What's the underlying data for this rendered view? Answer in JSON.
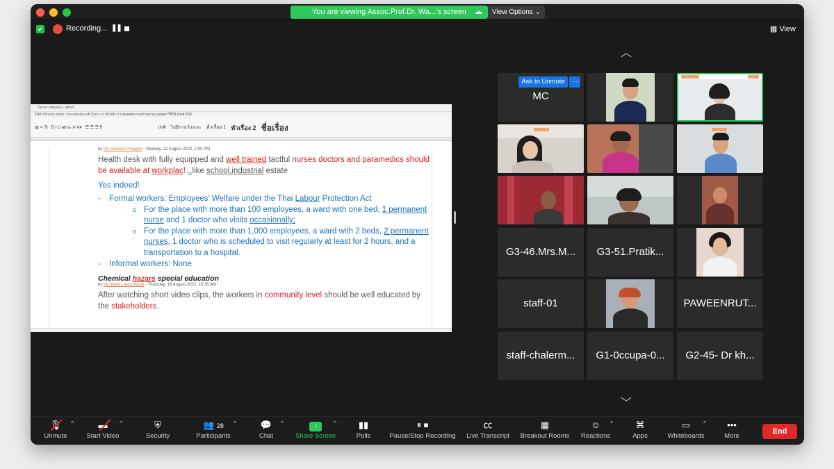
{
  "titlebar": {
    "share_banner": "You are viewing Assoc.Prof.Dr. Wa...'s screen",
    "view_options": "View Options ⌄"
  },
  "top_bar": {
    "recording_label": "Recording...",
    "view_label": "View"
  },
  "shared_doc": {
    "window_title": "โครงการสัมมนา - Word",
    "tabs": "ไฟล์   หน้าแรก   แทรก   วาด   ออกแบบ   เค้าโครง   การอ้างอิง   การส่งจดหมาย   ตรวจทาน   มุมมอง   วิธีใช้   Foxit PDF",
    "ribbon_styles": [
      "ปกติ",
      "ไม่มีการเว้นระยะ",
      "หัวเรื่อง 1",
      "หัวเรื่อง 2",
      "ชื่อเรื่อง"
    ],
    "meta1_prefix": "by ",
    "meta1_author": "Ms.Sareeta Prajapati",
    "meta1_date": " - Monday, 22 August 2022, 2:50 PM",
    "para1_a": "Health desk with fully equipped and ",
    "para1_b": "well trained",
    "para1_c": " tactful ",
    "para1_d": "nurses doctors and paramedics should be available at ",
    "para1_e": "workplac",
    "para1_f": "! ",
    "para1_g": "..",
    "para1_h": "like ",
    "para1_i": "school,industrial",
    "para1_j": " estate",
    "yes": "Yes indeed!",
    "formal_a": "Formal workers: Employees' Welfare under the Thai ",
    "formal_b": "Labour",
    "formal_c": " Protection Act",
    "sub1_a": "For the place with more than 100 employees, a ward with one bed, ",
    "sub1_b": "1 permanent nurse",
    "sub1_c": " and 1 doctor who visits ",
    "sub1_d": "occasionally;",
    "sub2_a": "For the place with more than 1,000 employees, a ward with 2 beds, ",
    "sub2_b": "2 permanent nurses",
    "sub2_c": ", 1 doctor who is scheduled to visit regularly at least for 2 hours, and a transportation to a hospital.",
    "informal": "Informal workers: None",
    "heading_a": "Chemical ",
    "heading_b": "hazars",
    "heading_c": " special education",
    "meta2_prefix": "by ",
    "meta2_author": "Mr.Nabin Lamichhane",
    "meta2_date": " - Thursday, 18 August 2022, 10:35 AM",
    "para2_a": "After watching short video clips, the workers in ",
    "para2_b": "community level",
    "para2_c": " should be well educated by the ",
    "para2_d": "stakeholders",
    "para2_e": "."
  },
  "gallery": {
    "mc_name": "MC",
    "ask_to_unmute": "Ask to Unmute",
    "more": "···",
    "names": [
      "G3-46.Mrs.M...",
      "G3-51.Pratik...",
      "staff-01",
      "PAWEENRUT...",
      "staff-chalerm...",
      "G1-0ccupa-0...",
      "G2-45- Dr kh..."
    ]
  },
  "toolbar": {
    "unmute": "Unmute",
    "start_video": "Start Video",
    "security": "Security",
    "participants": "Participants",
    "participants_count": "28",
    "chat": "Chat",
    "share_screen": "Share Screen",
    "polls": "Polls",
    "pause_stop_recording": "Pause/Stop Recording",
    "live_transcript": "Live Transcript",
    "breakout_rooms": "Breakout Rooms",
    "reactions": "Reactions",
    "apps": "Apps",
    "whiteboards": "Whiteboards",
    "more": "More",
    "end": "End"
  },
  "colors": {
    "accent_green": "#2ec95a",
    "end_red": "#e02a2a",
    "ask_blue": "#1a73e8",
    "doc_blue": "#1e73be",
    "doc_red": "#d62020"
  }
}
